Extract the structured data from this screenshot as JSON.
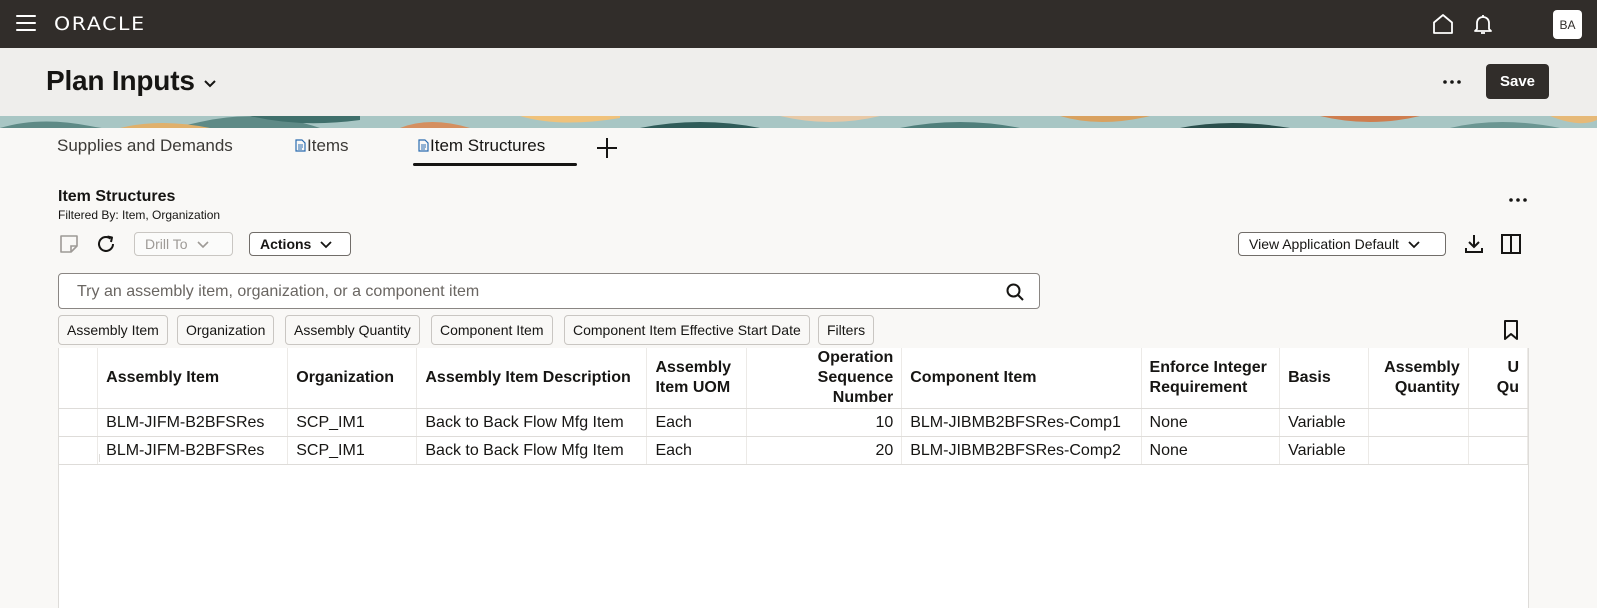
{
  "brand": {
    "logo": "ORACLE",
    "avatar_initials": "BA"
  },
  "topbar": {
    "icons": [
      "menu-icon",
      "home-icon",
      "bell-icon"
    ]
  },
  "header": {
    "title": "Plan Inputs",
    "save_label": "Save"
  },
  "tabs": [
    {
      "label": "Supplies and Demands",
      "active": false,
      "icon": ""
    },
    {
      "label": "Items",
      "active": false,
      "icon": "document-icon"
    },
    {
      "label": "Item Structures",
      "active": true,
      "icon": "document-icon"
    }
  ],
  "section": {
    "title": "Item Structures",
    "subtitle": "Filtered By: Item, Organization"
  },
  "toolbar": {
    "drill_to_label": "Drill To",
    "actions_label": "Actions",
    "view_label": "View Application Default"
  },
  "search": {
    "placeholder": "Try an assembly item, organization, or a component item",
    "value": ""
  },
  "chips": [
    "Assembly Item",
    "Organization",
    "Assembly Quantity",
    "Component Item",
    "Component Item Effective Start Date",
    "Filters"
  ],
  "table": {
    "headers": {
      "assembly_item": "Assembly Item",
      "organization": "Organization",
      "assembly_item_description": "Assembly Item Description",
      "assembly_item_uom_1": "Assembly",
      "assembly_item_uom_2": "Item UOM",
      "operation_seq_1": "Operation",
      "operation_seq_2": "Sequence Number",
      "component_item": "Component Item",
      "enforce_integer_1": "Enforce Integer",
      "enforce_integer_2": "Requirement",
      "basis": "Basis",
      "assembly_quantity_1": "Assembly",
      "assembly_quantity_2": "Quantity",
      "next_col_1": "U",
      "next_col_2": "Qu"
    },
    "rows": [
      {
        "assembly_item": "BLM-JIFM-B2BFSRes",
        "organization": "SCP_IM1",
        "description": "Back to Back Flow Mfg Item",
        "uom": "Each",
        "operation_seq": "10",
        "component_item": "BLM-JIBMB2BFSRes-Comp1",
        "enforce_integer": "None",
        "basis": "Variable",
        "assembly_quantity": "",
        "next": ""
      },
      {
        "assembly_item": "BLM-JIFM-B2BFSRes",
        "organization": "SCP_IM1",
        "description": "Back to Back Flow Mfg Item",
        "uom": "Each",
        "operation_seq": "20",
        "component_item": "BLM-JIBMB2BFSRes-Comp2",
        "enforce_integer": "None",
        "basis": "Variable",
        "assembly_quantity": "",
        "next": ""
      }
    ]
  },
  "colors": {
    "topbar": "#312d2a",
    "header": "#efeeec",
    "accent": "#161513"
  }
}
